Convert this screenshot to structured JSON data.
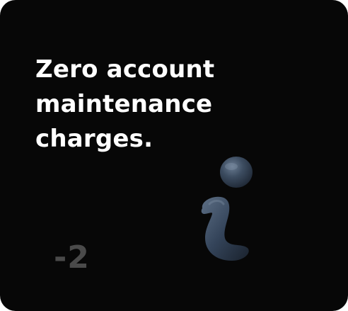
{
  "card": {
    "headline": "Zero account maintenance charges.",
    "step_number": "-2"
  },
  "icons": {
    "illustration": "info-icon"
  },
  "colors": {
    "card_background": "#070707",
    "headline_text": "#ffffff",
    "step_number_text": "#4a4a4a",
    "icon_fill": "#3a4a5e"
  }
}
